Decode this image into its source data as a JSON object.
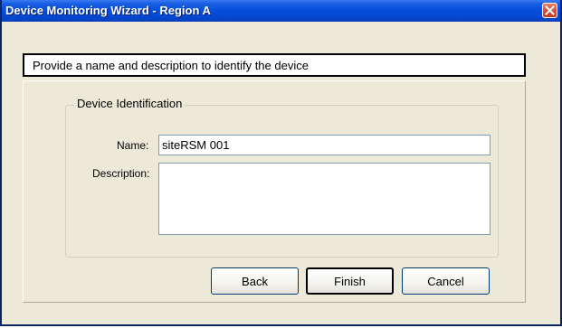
{
  "window": {
    "title": "Device Monitoring Wizard - Region A"
  },
  "header": {
    "instruction": "Provide a name and description to identify the device"
  },
  "group": {
    "title": "Device Identification"
  },
  "form": {
    "name_label": "Name:",
    "name_value": "siteRSM 001",
    "description_label": "Description:",
    "description_value": ""
  },
  "buttons": {
    "back": "Back",
    "finish": "Finish",
    "cancel": "Cancel"
  },
  "icons": {
    "close": "close-icon"
  },
  "colors": {
    "titlebar": "#0550dc",
    "close_button": "#d3543b",
    "dialog_background": "#ece9d8",
    "input_border": "#7f9db9"
  }
}
